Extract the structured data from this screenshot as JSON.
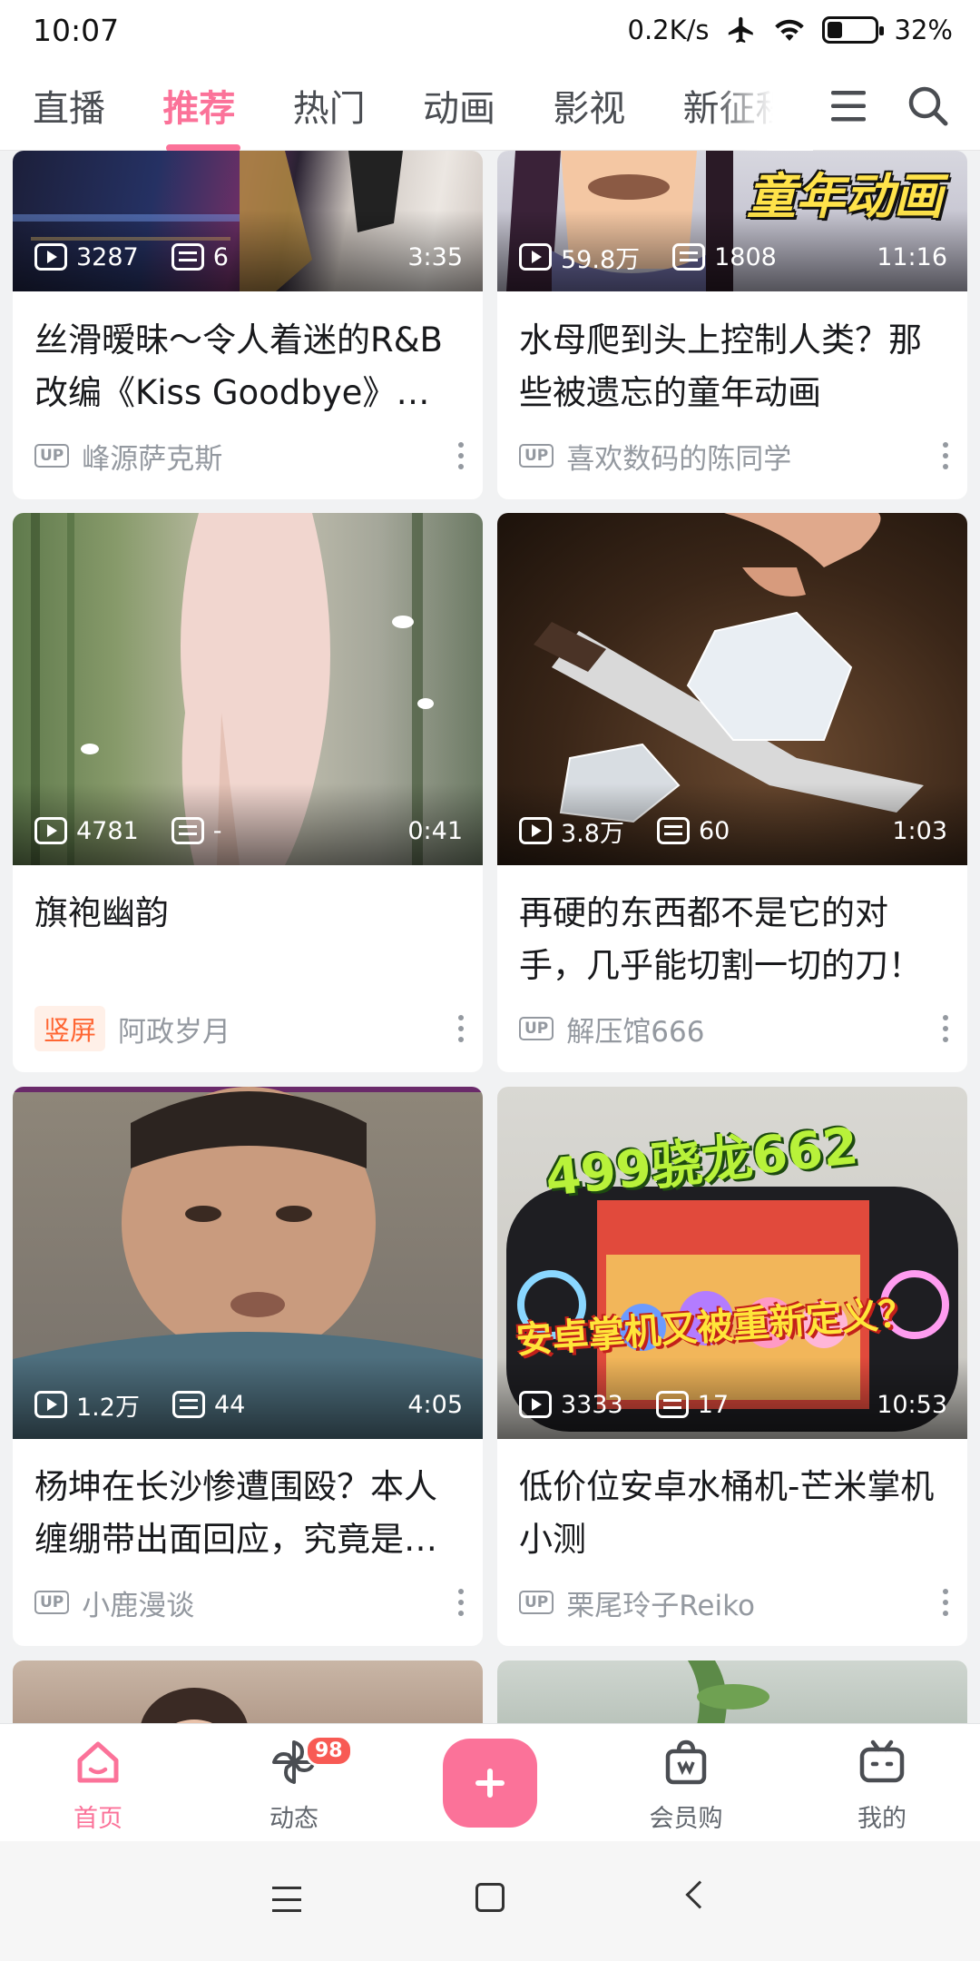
{
  "status_bar": {
    "time": "10:07",
    "net_speed": "0.2K/s",
    "battery": "32%",
    "battery_level": 0.32
  },
  "top_tabs": {
    "items": [
      "直播",
      "推荐",
      "热门",
      "动画",
      "影视",
      "新征程"
    ],
    "active_index": 1
  },
  "accent_color": "#fb7299",
  "feed": {
    "cards": [
      {
        "views": "3287",
        "danmaku": "6",
        "duration": "3:35",
        "title": "丝滑暧昧～令人着迷的R&B改编《Kiss Goodbye》每…",
        "author": "峰源萨克斯",
        "badge": "UP"
      },
      {
        "views": "59.8万",
        "danmaku": "1808",
        "duration": "11:16",
        "title": "水母爬到头上控制人类？那些被遗忘的童年动画",
        "author": "喜欢数码的陈同学",
        "badge": "UP",
        "thumb_text": "童年动画"
      },
      {
        "views": "4781",
        "danmaku": "-",
        "duration": "0:41",
        "title": "旗袍幽韵",
        "author": "阿政岁月",
        "badge": "竖屏"
      },
      {
        "views": "3.8万",
        "danmaku": "60",
        "duration": "1:03",
        "title": "再硬的东西都不是它的对手，几乎能切割一切的刀！",
        "author": "解压馆666",
        "badge": "UP"
      },
      {
        "views": "1.2万",
        "danmaku": "44",
        "duration": "4:05",
        "title": "杨坤在长沙惨遭围殴？本人缠绷带出面回应，究竟是…",
        "author": "小鹿漫谈",
        "badge": "UP"
      },
      {
        "views": "3333",
        "danmaku": "17",
        "duration": "10:53",
        "title": "低价位安卓水桶机-芒米掌机小测",
        "author": "栗尾玲子Reiko",
        "badge": "UP",
        "thumb_text": "499骁龙662",
        "thumb_text2": "安卓掌机又被重新定义？"
      }
    ]
  },
  "bottom_nav": {
    "items": [
      {
        "label": "首页",
        "icon": "home-icon"
      },
      {
        "label": "动态",
        "icon": "pinwheel-icon",
        "badge": "98"
      },
      {
        "label": "",
        "icon": "plus-icon"
      },
      {
        "label": "会员购",
        "icon": "shopping-bag-icon"
      },
      {
        "label": "我的",
        "icon": "tv-icon"
      }
    ],
    "active_index": 0
  }
}
